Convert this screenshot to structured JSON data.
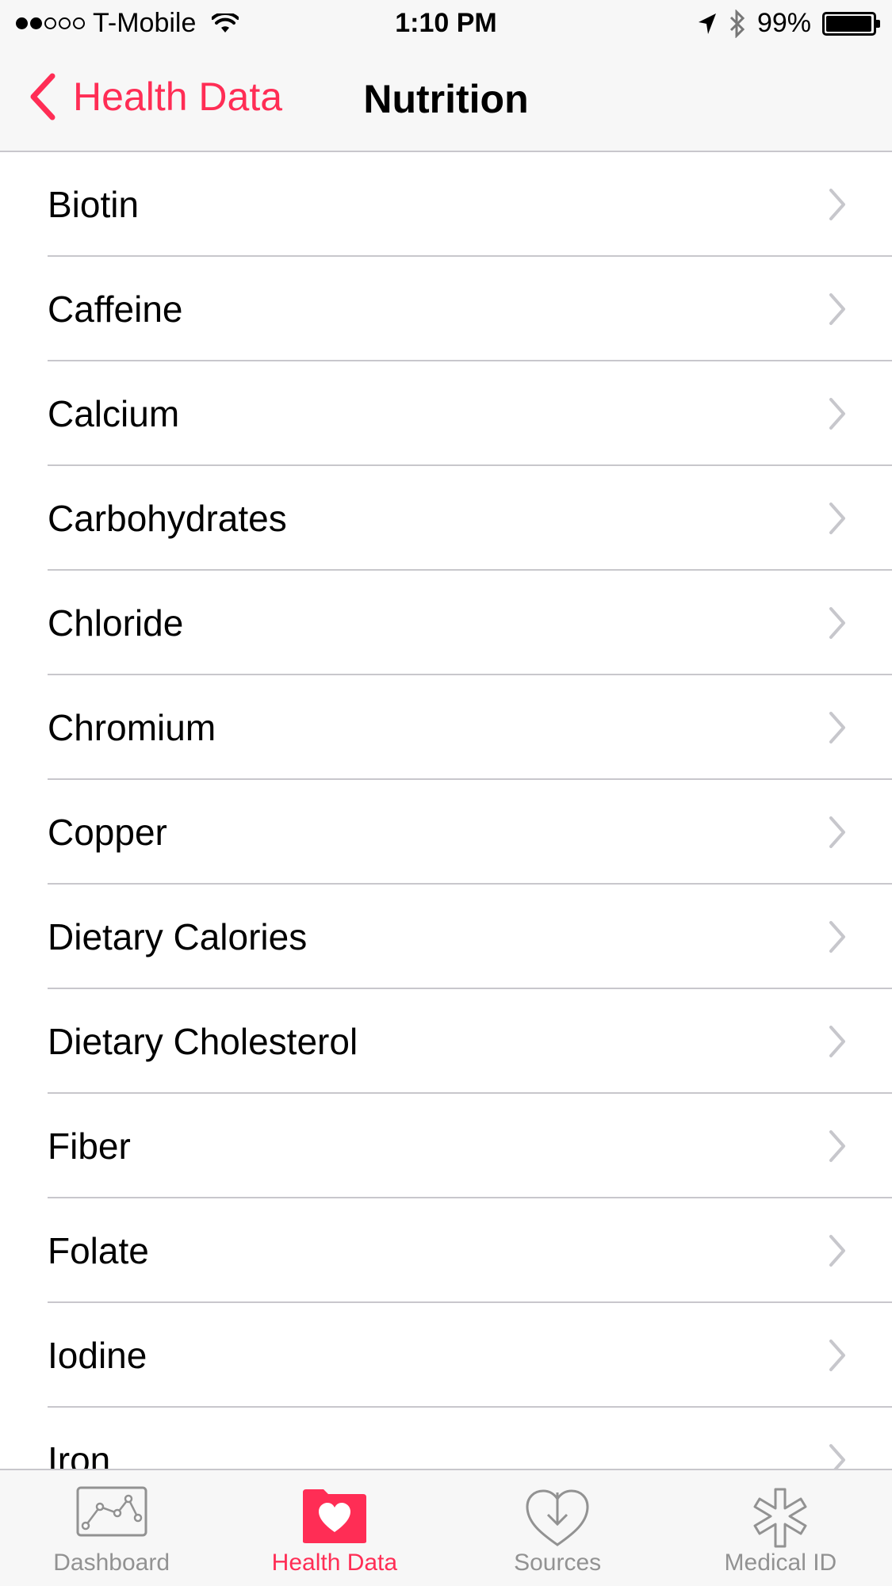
{
  "status_bar": {
    "signal_filled": 2,
    "signal_total": 5,
    "carrier": "T-Mobile",
    "time": "1:10 PM",
    "battery_text": "99%",
    "battery_level": 0.99
  },
  "nav": {
    "back_label": "Health Data",
    "title": "Nutrition"
  },
  "list": {
    "items": [
      {
        "label": "Biotin"
      },
      {
        "label": "Caffeine"
      },
      {
        "label": "Calcium"
      },
      {
        "label": "Carbohydrates"
      },
      {
        "label": "Chloride"
      },
      {
        "label": "Chromium"
      },
      {
        "label": "Copper"
      },
      {
        "label": "Dietary Calories"
      },
      {
        "label": "Dietary Cholesterol"
      },
      {
        "label": "Fiber"
      },
      {
        "label": "Folate"
      },
      {
        "label": "Iodine"
      },
      {
        "label": "Iron"
      }
    ]
  },
  "tabs": [
    {
      "label": "Dashboard",
      "icon": "dashboard-icon",
      "active": false
    },
    {
      "label": "Health Data",
      "icon": "health-data-icon",
      "active": true
    },
    {
      "label": "Sources",
      "icon": "sources-icon",
      "active": false
    },
    {
      "label": "Medical ID",
      "icon": "medical-id-icon",
      "active": false
    }
  ],
  "colors": {
    "accent": "#ff2d55",
    "tab_inactive": "#929292",
    "chevron": "#c7c7cc",
    "separator": "#c8c7cc",
    "bar_background": "#f7f7f7"
  }
}
